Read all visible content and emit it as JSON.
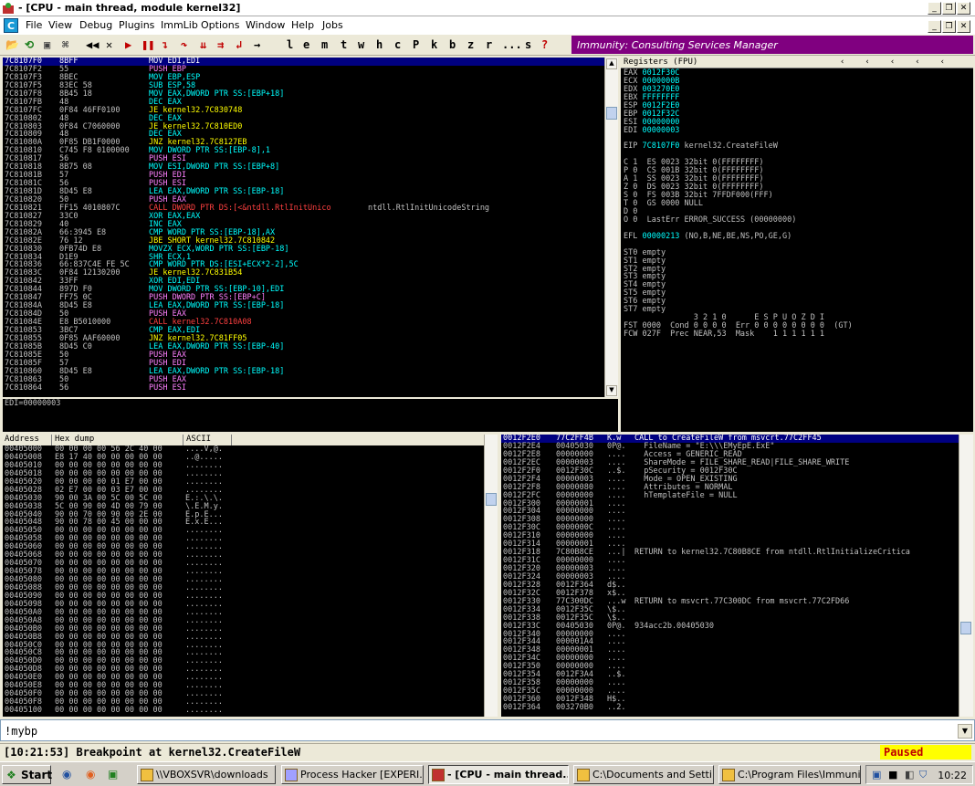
{
  "window": {
    "title": "- [CPU - main thread, module kernel32]"
  },
  "menu": [
    "File",
    "View",
    "Debug",
    "Plugins",
    "ImmLib",
    "Options",
    "Window",
    "Help",
    "Jobs"
  ],
  "toolbar": {
    "letters": [
      "l",
      "e",
      "m",
      "t",
      "w",
      "h",
      "c",
      "P",
      "k",
      "b",
      "z",
      "r",
      "...",
      "s",
      "?"
    ],
    "banner": "Immunity: Consulting Services Manager"
  },
  "cpu": {
    "rows": [
      [
        "7C8107F0",
        "8BFF",
        "MOV EDI,EDI",
        ""
      ],
      [
        "7C8107F2",
        "55",
        "PUSH EBP",
        ""
      ],
      [
        "7C8107F3",
        "8BEC",
        "MOV EBP,ESP",
        ""
      ],
      [
        "7C8107F5",
        "83EC 58",
        "SUB ESP,58",
        ""
      ],
      [
        "7C8107F8",
        "8B45 18",
        "MOV EAX,DWORD PTR SS:[EBP+18]",
        ""
      ],
      [
        "7C8107FB",
        "48",
        "DEC EAX",
        ""
      ],
      [
        "7C8107FC",
        "0F84 46FF0100",
        "JE kernel32.7C830748",
        ""
      ],
      [
        "7C810802",
        "48",
        "DEC EAX",
        ""
      ],
      [
        "7C810803",
        "0F84 C7060000",
        "JE kernel32.7C810ED0",
        ""
      ],
      [
        "7C810809",
        "48",
        "DEC EAX",
        ""
      ],
      [
        "7C81080A",
        "0F85 DB1F0000",
        "JNZ kernel32.7C8127EB",
        ""
      ],
      [
        "7C810810",
        "C745 F8 0100000",
        "MOV DWORD PTR SS:[EBP-8],1",
        ""
      ],
      [
        "7C810817",
        "56",
        "PUSH ESI",
        ""
      ],
      [
        "7C810818",
        "8B75 08",
        "MOV ESI,DWORD PTR SS:[EBP+8]",
        ""
      ],
      [
        "7C81081B",
        "57",
        "PUSH EDI",
        ""
      ],
      [
        "7C81081C",
        "56",
        "PUSH ESI",
        ""
      ],
      [
        "7C81081D",
        "8D45 E8",
        "LEA EAX,DWORD PTR SS:[EBP-18]",
        ""
      ],
      [
        "7C810820",
        "50",
        "PUSH EAX",
        ""
      ],
      [
        "7C810821",
        "FF15 4010807C",
        "CALL DWORD PTR DS:[<&ntdll.RtlInitUnico",
        "ntdll.RtlInitUnicodeString"
      ],
      [
        "7C810827",
        "33C0",
        "XOR EAX,EAX",
        ""
      ],
      [
        "7C810829",
        "40",
        "INC EAX",
        ""
      ],
      [
        "7C81082A",
        "66:3945 E8",
        "CMP WORD PTR SS:[EBP-18],AX",
        ""
      ],
      [
        "7C81082E",
        "76 12",
        "JBE SHORT kernel32.7C810842",
        ""
      ],
      [
        "7C810830",
        "0FB74D E8",
        "MOVZX ECX,WORD PTR SS:[EBP-18]",
        ""
      ],
      [
        "7C810834",
        "D1E9",
        "SHR ECX,1",
        ""
      ],
      [
        "7C810836",
        "66:837C4E FE 5C",
        "CMP WORD PTR DS:[ESI+ECX*2-2],5C",
        ""
      ],
      [
        "7C81083C",
        "0F84 12130200",
        "JE kernel32.7C831B54",
        ""
      ],
      [
        "7C810842",
        "33FF",
        "XOR EDI,EDI",
        ""
      ],
      [
        "7C810844",
        "897D F0",
        "MOV DWORD PTR SS:[EBP-10],EDI",
        ""
      ],
      [
        "7C810847",
        "FF75 0C",
        "PUSH DWORD PTR SS:[EBP+C]",
        ""
      ],
      [
        "7C81084A",
        "8D45 E8",
        "LEA EAX,DWORD PTR SS:[EBP-18]",
        ""
      ],
      [
        "7C81084D",
        "50",
        "PUSH EAX",
        ""
      ],
      [
        "7C81084E",
        "E8 B5010000",
        "CALL kernel32.7C810A08",
        ""
      ],
      [
        "7C810853",
        "3BC7",
        "CMP EAX,EDI",
        ""
      ],
      [
        "7C810855",
        "0F85 AAF60000",
        "JNZ kernel32.7C81FF05",
        ""
      ],
      [
        "7C81085B",
        "8D45 C0",
        "LEA EAX,DWORD PTR SS:[EBP-40]",
        ""
      ],
      [
        "7C81085E",
        "50",
        "PUSH EAX",
        ""
      ],
      [
        "7C81085F",
        "57",
        "PUSH EDI",
        ""
      ],
      [
        "7C810860",
        "8D45 E8",
        "LEA EAX,DWORD PTR SS:[EBP-18]",
        ""
      ],
      [
        "7C810863",
        "50",
        "PUSH EAX",
        ""
      ],
      [
        "7C810864",
        "56",
        "PUSH ESI",
        ""
      ]
    ],
    "info": "EDI=00000003"
  },
  "registers": {
    "header": "Registers (FPU)",
    "lines": [
      [
        "EAX ",
        "0012F30C",
        ""
      ],
      [
        "ECX ",
        "0000000B",
        ""
      ],
      [
        "EDX ",
        "003270E0",
        ""
      ],
      [
        "EBX ",
        "FFFFFFFF",
        ""
      ],
      [
        "ESP ",
        "0012F2E0",
        ""
      ],
      [
        "EBP ",
        "0012F32C",
        ""
      ],
      [
        "ESI ",
        "00000000",
        ""
      ],
      [
        "EDI ",
        "00000003",
        ""
      ],
      [
        "",
        "",
        ""
      ],
      [
        "EIP ",
        "7C8107F0",
        " kernel32.CreateFileW"
      ],
      [
        "",
        "",
        ""
      ],
      [
        "C 1  ",
        "",
        "ES 0023 32bit 0(FFFFFFFF)"
      ],
      [
        "P 0  ",
        "",
        "CS 001B 32bit 0(FFFFFFFF)"
      ],
      [
        "A 1  ",
        "",
        "SS 0023 32bit 0(FFFFFFFF)"
      ],
      [
        "Z 0  ",
        "",
        "DS 0023 32bit 0(FFFFFFFF)"
      ],
      [
        "S 0  ",
        "",
        "FS 003B 32bit 7FFDF000(FFF)"
      ],
      [
        "T 0  ",
        "",
        "GS 0000 NULL"
      ],
      [
        "D 0",
        "",
        ""
      ],
      [
        "O 0  ",
        "",
        "LastErr ERROR_SUCCESS (00000000)"
      ],
      [
        "",
        "",
        ""
      ],
      [
        "EFL ",
        "00000213",
        " (NO,B,NE,BE,NS,PO,GE,G)"
      ],
      [
        "",
        "",
        ""
      ],
      [
        "ST0 empty",
        "",
        ""
      ],
      [
        "ST1 empty",
        "",
        ""
      ],
      [
        "ST2 empty",
        "",
        ""
      ],
      [
        "ST3 empty",
        "",
        ""
      ],
      [
        "ST4 empty",
        "",
        ""
      ],
      [
        "ST5 empty",
        "",
        ""
      ],
      [
        "ST6 empty",
        "",
        ""
      ],
      [
        "ST7 empty",
        "",
        ""
      ],
      [
        "               3 2 1 0      E S P U O Z D I",
        "",
        ""
      ],
      [
        "FST 0000  Cond 0 0 0 0  Err 0 0 0 0 0 0 0 0  (GT)",
        "",
        ""
      ],
      [
        "FCW 027F  Prec NEAR,53  Mask    1 1 1 1 1 1",
        "",
        ""
      ]
    ]
  },
  "dump": {
    "headers": [
      "Address",
      "Hex dump",
      "ASCII"
    ],
    "rows": [
      [
        "00405000",
        "00 00 00 00 56 2C 40 00",
        "....V,@."
      ],
      [
        "00405008",
        "E8 17 40 00 00 00 00 00",
        "..@....."
      ],
      [
        "00405010",
        "00 00 00 00 00 00 00 00",
        "........"
      ],
      [
        "00405018",
        "00 00 00 00 00 00 00 00",
        "........"
      ],
      [
        "00405020",
        "00 00 00 00 01 E7 00 00",
        "........"
      ],
      [
        "00405028",
        "02 E7 00 00 03 E7 00 00",
        "........"
      ],
      [
        "00405030",
        "90 00 3A 00 5C 00 5C 00",
        "E.:.\\.\\."
      ],
      [
        "00405038",
        "5C 00 90 00 4D 00 79 00",
        "\\.E.M.y."
      ],
      [
        "00405040",
        "90 00 70 00 90 00 2E 00",
        "E.p.E..."
      ],
      [
        "00405048",
        "90 00 78 00 45 00 00 00",
        "E.x.E..."
      ],
      [
        "00405050",
        "00 00 00 00 00 00 00 00",
        "........"
      ],
      [
        "00405058",
        "00 00 00 00 00 00 00 00",
        "........"
      ],
      [
        "00405060",
        "00 00 00 00 00 00 00 00",
        "........"
      ],
      [
        "00405068",
        "00 00 00 00 00 00 00 00",
        "........"
      ],
      [
        "00405070",
        "00 00 00 00 00 00 00 00",
        "........"
      ],
      [
        "00405078",
        "00 00 00 00 00 00 00 00",
        "........"
      ],
      [
        "00405080",
        "00 00 00 00 00 00 00 00",
        "........"
      ],
      [
        "00405088",
        "00 00 00 00 00 00 00 00",
        "........"
      ],
      [
        "00405090",
        "00 00 00 00 00 00 00 00",
        "........"
      ],
      [
        "00405098",
        "00 00 00 00 00 00 00 00",
        "........"
      ],
      [
        "004050A0",
        "00 00 00 00 00 00 00 00",
        "........"
      ],
      [
        "004050A8",
        "00 00 00 00 00 00 00 00",
        "........"
      ],
      [
        "004050B0",
        "00 00 00 00 00 00 00 00",
        "........"
      ],
      [
        "004050B8",
        "00 00 00 00 00 00 00 00",
        "........"
      ],
      [
        "004050C0",
        "00 00 00 00 00 00 00 00",
        "........"
      ],
      [
        "004050C8",
        "00 00 00 00 00 00 00 00",
        "........"
      ],
      [
        "004050D0",
        "00 00 00 00 00 00 00 00",
        "........"
      ],
      [
        "004050D8",
        "00 00 00 00 00 00 00 00",
        "........"
      ],
      [
        "004050E0",
        "00 00 00 00 00 00 00 00",
        "........"
      ],
      [
        "004050E8",
        "00 00 00 00 00 00 00 00",
        "........"
      ],
      [
        "004050F0",
        "00 00 00 00 00 00 00 00",
        "........"
      ],
      [
        "004050F8",
        "00 00 00 00 00 00 00 00",
        "........"
      ],
      [
        "00405100",
        "00 00 00 00 00 00 00 00",
        "........"
      ]
    ]
  },
  "stack": {
    "rows": [
      [
        "0012F2E0",
        "77C2FF4B",
        "K.w",
        "CALL to CreateFileW from msvcrt.77C2FF45"
      ],
      [
        "0012F2E4",
        "00405030",
        "0P@.",
        "  FileName = \"E:\\\\\\EMyEpE.ExE\""
      ],
      [
        "0012F2E8",
        "00000000",
        "....",
        "  Access = GENERIC_READ"
      ],
      [
        "0012F2EC",
        "00000003",
        "....",
        "  ShareMode = FILE_SHARE_READ|FILE_SHARE_WRITE"
      ],
      [
        "0012F2F0",
        "0012F30C",
        "..$.",
        "  pSecurity = 0012F30C"
      ],
      [
        "0012F2F4",
        "00000003",
        "....",
        "  Mode = OPEN_EXISTING"
      ],
      [
        "0012F2F8",
        "00000080",
        "....",
        "  Attributes = NORMAL"
      ],
      [
        "0012F2FC",
        "00000000",
        "....",
        "  hTemplateFile = NULL"
      ],
      [
        "0012F300",
        "00000001",
        "....",
        ""
      ],
      [
        "0012F304",
        "00000000",
        "....",
        ""
      ],
      [
        "0012F308",
        "00000000",
        "....",
        ""
      ],
      [
        "0012F30C",
        "0000000C",
        "....",
        ""
      ],
      [
        "0012F310",
        "00000000",
        "....",
        ""
      ],
      [
        "0012F314",
        "00000001",
        "....",
        ""
      ],
      [
        "0012F318",
        "7C80B8CE",
        "...|",
        "RETURN to kernel32.7C80B8CE from ntdll.RtlInitializeCritica"
      ],
      [
        "0012F31C",
        "00000000",
        "....",
        ""
      ],
      [
        "0012F320",
        "00000003",
        "....",
        ""
      ],
      [
        "0012F324",
        "00000003",
        "....",
        ""
      ],
      [
        "0012F328",
        "0012F364",
        "d$..",
        ""
      ],
      [
        "0012F32C",
        "0012F378",
        "x$..",
        ""
      ],
      [
        "0012F330",
        "77C300DC",
        "...w",
        "RETURN to msvcrt.77C300DC from msvcrt.77C2FD66"
      ],
      [
        "0012F334",
        "0012F35C",
        "\\$..",
        ""
      ],
      [
        "0012F338",
        "0012F35C",
        "\\$..",
        ""
      ],
      [
        "0012F33C",
        "00405030",
        "0P@.",
        "934acc2b.00405030"
      ],
      [
        "0012F340",
        "00000000",
        "....",
        ""
      ],
      [
        "0012F344",
        "000001A4",
        "....",
        ""
      ],
      [
        "0012F348",
        "00000001",
        "....",
        ""
      ],
      [
        "0012F34C",
        "00000000",
        "....",
        ""
      ],
      [
        "0012F350",
        "00000000",
        "....",
        ""
      ],
      [
        "0012F354",
        "0012F3A4",
        "..$.",
        ""
      ],
      [
        "0012F358",
        "00000000",
        "....",
        ""
      ],
      [
        "0012F35C",
        "00000000",
        "....",
        ""
      ],
      [
        "0012F360",
        "0012F348",
        "H$..",
        ""
      ],
      [
        "0012F364",
        "003270B0",
        "..2.",
        ""
      ]
    ]
  },
  "command": {
    "value": "!mybp"
  },
  "status": {
    "message": "[10:21:53] Breakpoint at kernel32.CreateFileW",
    "state": "Paused"
  },
  "taskbar": {
    "start": "Start",
    "tasks": [
      "\\\\VBOXSVR\\downloads",
      "Process Hacker [EXPERI...",
      "- [CPU - main thread...",
      "C:\\Documents and Setti...",
      "C:\\Program Files\\Immuni..."
    ],
    "clock": "10:22"
  },
  "colors": {
    "banner": "#800080",
    "selection": "#000080",
    "paused_bg": "#ffff00",
    "paused_fg": "#c00000"
  }
}
